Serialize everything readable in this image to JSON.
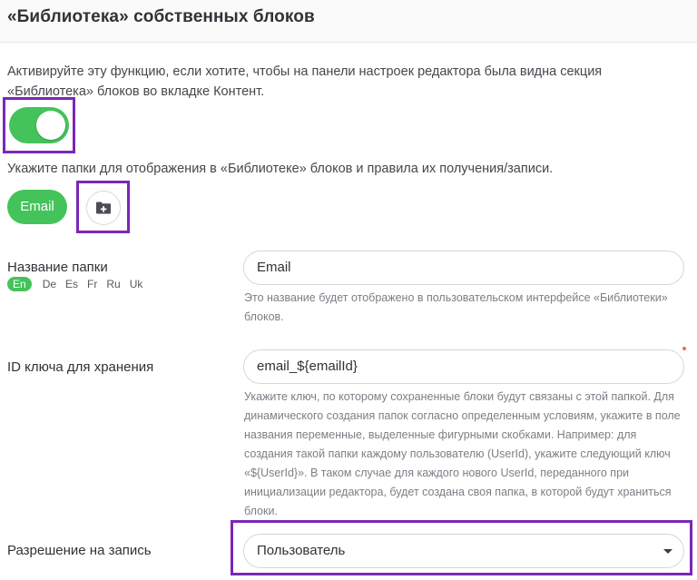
{
  "header": {
    "title": "«Библиотека» собственных блоков"
  },
  "description": "Активируйте эту функцию, если хотите, чтобы на панели настроек редактора была видна секция «Библиотека» блоков во вкладке Контент.",
  "toggle": {
    "enabled": true,
    "color": "#44c35a"
  },
  "folders_hint": "Укажите папки для отображения в «Библиотеке» блоков и правила их получения/записи.",
  "folders": {
    "chip_label": "Email",
    "add_icon": "folder-plus-icon"
  },
  "folder_name": {
    "label": "Название папки",
    "languages": [
      "En",
      "De",
      "Es",
      "Fr",
      "Ru",
      "Uk"
    ],
    "active_language": "En",
    "value": "Email",
    "help": "Это название будет отображено в пользовательском интерфейсе «Библиотеки» блоков."
  },
  "storage_key": {
    "label": "ID ключа для хранения",
    "value": "email_${emailId}",
    "help": "Укажите ключ, по которому сохраненные блоки будут связаны с этой папкой. Для динамического создания папок согласно определенным условиям, укажите в поле названия переменные, выделенные фигурными скобками. Например: для создания такой папки каждому пользователю (UserId), укажите следующий ключ «${UserId}». В таком случае для каждого нового UserId, переданного при инициализации редактора, будет создана своя папка, в которой будут храниться блоки."
  },
  "write_permission": {
    "label": "Разрешение на запись",
    "value": "Пользователь"
  },
  "colors": {
    "accent": "#44c35a",
    "highlight": "#7b26b8"
  }
}
